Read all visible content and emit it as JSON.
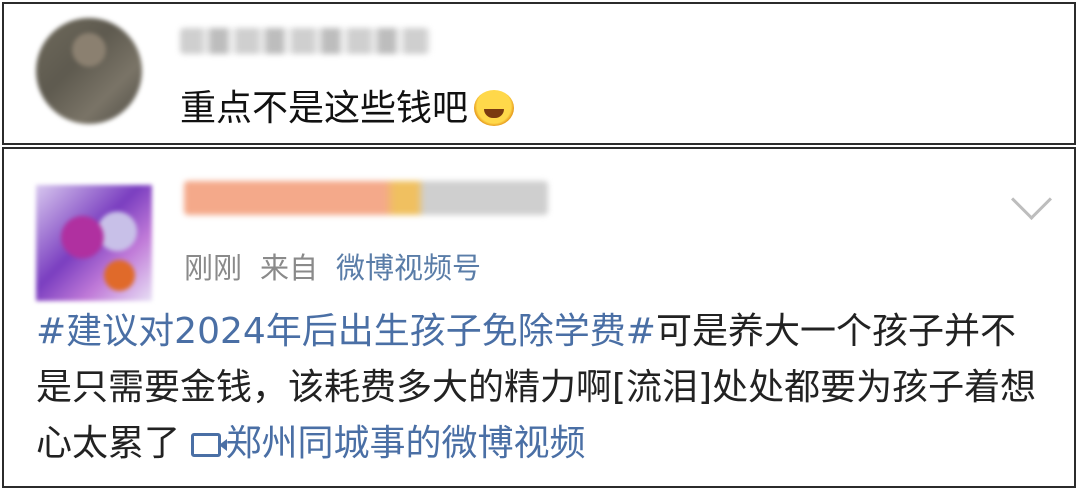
{
  "reply": {
    "text": "重点不是这些钱吧"
  },
  "post": {
    "time": "刚刚",
    "from_label": "来自",
    "source": "微博视频号",
    "hashtag": "#建议对2024年后出生孩子免除学费#",
    "body": "可是养大一个孩子并不是只需要金钱，该耗费多大的精力啊[流泪]处处都要为孩子着想心太累了",
    "video_link": "郑州同城事的微博视频"
  },
  "icons": {
    "reply_emoji": "laughing-tears-emoji",
    "menu": "chevron-down-icon",
    "video": "video-icon"
  },
  "colors": {
    "link": "#4a6fa5",
    "meta": "#8a8a8a",
    "border": "#2b2b2b"
  }
}
